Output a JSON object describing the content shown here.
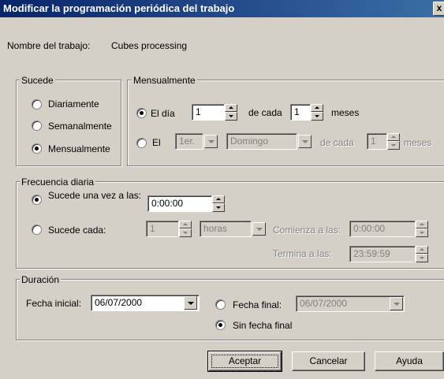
{
  "window": {
    "title": "Modificar la programación periódica del trabajo",
    "close_label": "x"
  },
  "job": {
    "label": "Nombre del trabajo:",
    "value": "Cubes processing"
  },
  "occurs": {
    "legend": "Sucede",
    "options": [
      {
        "label": "Diariamente",
        "checked": false
      },
      {
        "label": "Semanalmente",
        "checked": false
      },
      {
        "label": "Mensualmente",
        "checked": true
      }
    ]
  },
  "monthly": {
    "legend": "Mensualmente",
    "day_option": {
      "label": "El día",
      "day_value": "1",
      "every_label": "de cada",
      "months_value": "1",
      "months_label": "meses",
      "checked": true
    },
    "the_option": {
      "label": "El",
      "ordinal": "1er.",
      "weekday": "Domingo",
      "every_label": "de cada",
      "months_value": "1",
      "months_label": "meses",
      "checked": false
    }
  },
  "daily": {
    "legend": "Frecuencia diaria",
    "once_label": "Sucede una vez a las:",
    "once_time": "0:00:00",
    "every_label": "Sucede cada:",
    "every_value": "1",
    "every_unit": "horas",
    "start_label": "Comienza a las:",
    "start_time": "0:00:00",
    "end_label": "Termina a las:",
    "end_time": "23:59:59"
  },
  "duration": {
    "legend": "Duración",
    "start_label": "Fecha inicial:",
    "start_date": "06/07/2000",
    "end_label": "Fecha final:",
    "end_date": "06/07/2000",
    "no_end_label": "Sin fecha final"
  },
  "buttons": {
    "ok": "Aceptar",
    "cancel": "Cancelar",
    "help": "Ayuda"
  }
}
